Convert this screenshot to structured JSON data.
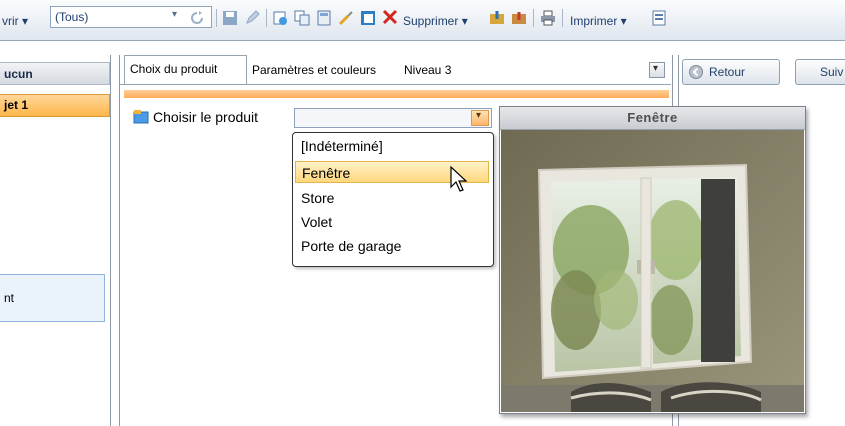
{
  "toolbar": {
    "open_label": "vrir",
    "filter_value": "(Tous)",
    "delete_label": "Supprimer",
    "print_label": "Imprimer"
  },
  "left_pane": {
    "header": "ucun",
    "selected_item": "jet 1",
    "box_item": "nt"
  },
  "tabs": [
    "Choix du produit",
    "Paramètres et couleurs",
    "Niveau 3"
  ],
  "product_field": {
    "label": "Choisir le produit",
    "options": [
      "[Indéterminé]",
      "Fenêtre",
      "Store",
      "Volet",
      "Porte de garage"
    ],
    "highlighted": "Fenêtre"
  },
  "right_panel": {
    "back_label": "Retour",
    "next_label": "Suiv"
  },
  "preview": {
    "title": "Fenêtre"
  },
  "colors": {
    "accent_orange": "#ffac5a",
    "selection_yellow": "#ffd77d",
    "toolbar_blue": "#1f3f6d"
  }
}
